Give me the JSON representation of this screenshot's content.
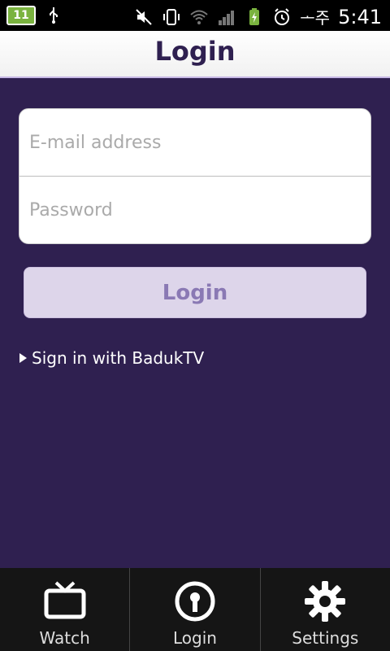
{
  "status_bar": {
    "badge_text": "11",
    "carrier": "ᅩ주",
    "time": "5:41"
  },
  "titlebar": {
    "title": "Login"
  },
  "form": {
    "email_placeholder": "E-mail address",
    "password_placeholder": "Password"
  },
  "login_button": {
    "label": "Login"
  },
  "sign_in_link": {
    "label": "Sign in with BadukTV"
  },
  "bottom_nav": {
    "items": [
      {
        "label": "Watch",
        "icon": "tv-icon"
      },
      {
        "label": "Login",
        "icon": "keyhole-icon"
      },
      {
        "label": "Settings",
        "icon": "gear-icon"
      }
    ]
  },
  "colors": {
    "background": "#2f2050",
    "title": "#2f2050",
    "button_bg": "#ddd5ea",
    "button_text": "#8a79b4"
  }
}
